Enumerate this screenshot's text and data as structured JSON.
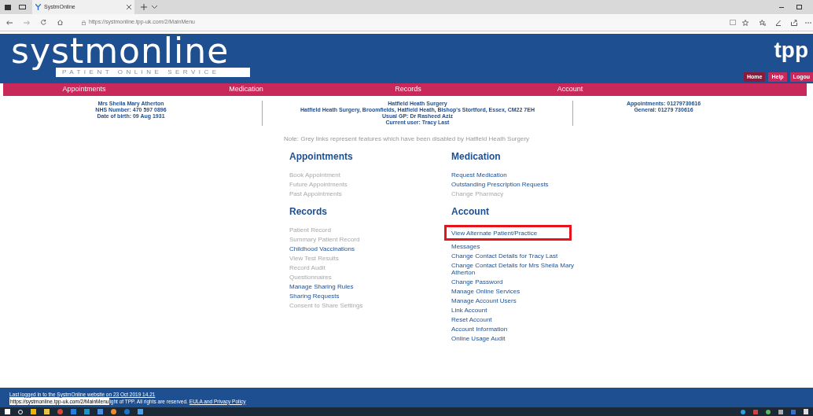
{
  "browser": {
    "tab_title": "SystmOnline",
    "url": "https://systmonline.tpp-uk.com/2/MainMenu"
  },
  "header": {
    "logo": "systmonline",
    "tagline": "PATIENT ONLINE SERVICE",
    "brand": "tpp",
    "buttons": [
      {
        "label": "Home",
        "selected": true
      },
      {
        "label": "Help",
        "selected": false
      },
      {
        "label": "Logou",
        "selected": false
      }
    ]
  },
  "nav": [
    "Appointments",
    "Medication",
    "Records",
    "Account"
  ],
  "patient": [
    "Mrs Sheila Mary Atherton",
    "NHS Number: 470 597 0896",
    "Date of birth: 09 Aug 1931"
  ],
  "practice": [
    "Hatfield Heath Surgery",
    "Hatfield Heath Surgery,  Broomfields, Hatfield Heath, Bishop's Stortford, Essex, CM22 7EH",
    "Usual GP: Dr Rasheed Aziz",
    "Current user: Tracy Last"
  ],
  "contacts": [
    {
      "label": "Appointments: ",
      "number": "01279730616"
    },
    {
      "label": "General: ",
      "number": "01279 730616"
    }
  ],
  "note": "Note: Grey links represent features which have been disabled by Hatfield Heath Surgery",
  "sections": [
    {
      "title": "Appointments",
      "items": [
        {
          "label": "Book Appointment",
          "enabled": false
        },
        {
          "label": "Future Appointments",
          "enabled": false
        },
        {
          "label": "Past Appointments",
          "enabled": false
        }
      ]
    },
    {
      "title": "Medication",
      "items": [
        {
          "label": "Request Medication",
          "enabled": true
        },
        {
          "label": "Outstanding Prescription Requests",
          "enabled": true
        },
        {
          "label": "Change Pharmacy",
          "enabled": false
        }
      ]
    },
    {
      "title": "Records",
      "items": [
        {
          "label": "Patient Record",
          "enabled": false
        },
        {
          "label": "Summary Patient Record",
          "enabled": false
        },
        {
          "label": "Childhood Vaccinations",
          "enabled": true
        },
        {
          "label": "View Test Results",
          "enabled": false
        },
        {
          "label": "Record Audit",
          "enabled": false
        },
        {
          "label": "Questionnaires",
          "enabled": false
        },
        {
          "label": "Manage Sharing Rules",
          "enabled": true
        },
        {
          "label": "Sharing Requests",
          "enabled": true
        },
        {
          "label": "Consent to Share Settings",
          "enabled": false
        }
      ]
    },
    {
      "title": "Account",
      "items": [
        {
          "label": "View Alternate Patient/Practice",
          "enabled": true,
          "highlighted": true
        },
        {
          "label": "Messages",
          "enabled": true
        },
        {
          "label": "Change Contact Details for Tracy Last",
          "enabled": true
        },
        {
          "label": "Change Contact Details for Mrs Sheila Mary Atherton",
          "enabled": true
        },
        {
          "label": "Change Password",
          "enabled": true
        },
        {
          "label": "Manage Online Services",
          "enabled": true
        },
        {
          "label": "Manage Account Users",
          "enabled": true
        },
        {
          "label": "Link Account",
          "enabled": true
        },
        {
          "label": "Reset Account",
          "enabled": true
        },
        {
          "label": "Account Information",
          "enabled": true
        },
        {
          "label": "Online Usage Audit",
          "enabled": true
        }
      ]
    }
  ],
  "footer": {
    "last_login": "Last logged in to the SystmOnline website on 23 Oct 2019 14.21",
    "status_tooltip": "https://systmonline.tpp-uk.com/2/MainMenu",
    "copyright": "ight of TPP. All rights are reserved.",
    "link": "EULA and Privacy Policy"
  }
}
